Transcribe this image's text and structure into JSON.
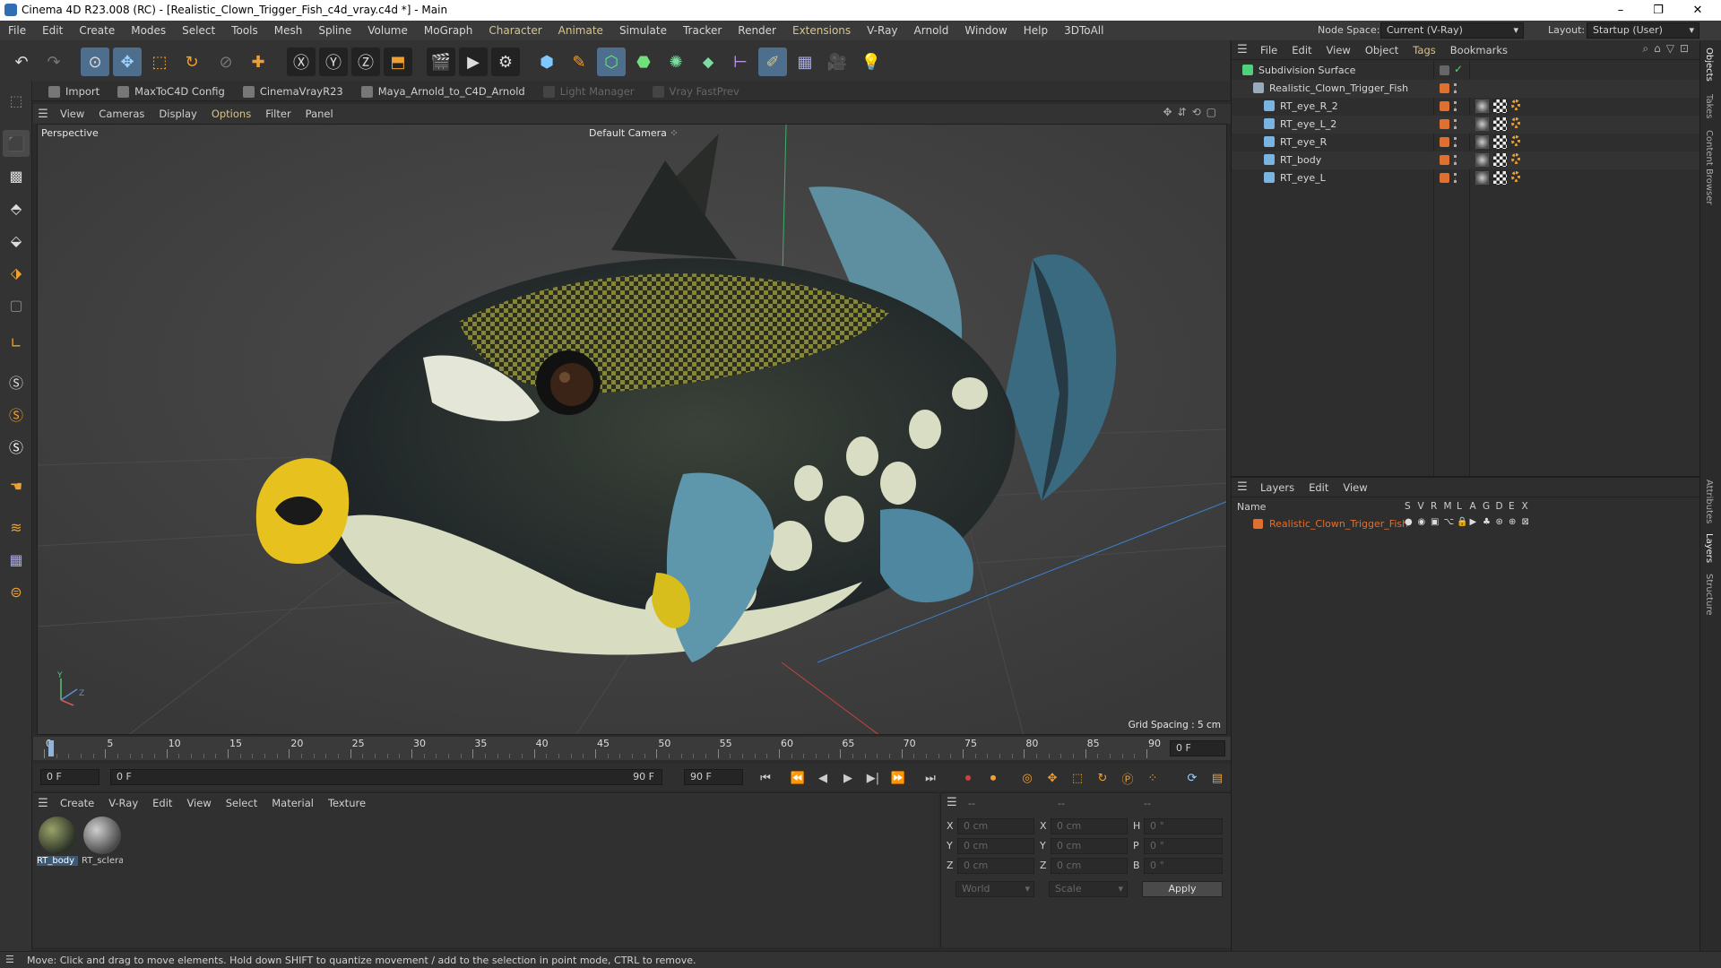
{
  "window": {
    "title": "Cinema 4D R23.008 (RC) - [Realistic_Clown_Trigger_Fish_c4d_vray.c4d *] - Main",
    "controls": [
      "–",
      "❐",
      "✕"
    ]
  },
  "menubar": {
    "items": [
      "File",
      "Edit",
      "Create",
      "Modes",
      "Select",
      "Tools",
      "Mesh",
      "Spline",
      "Volume",
      "MoGraph",
      "Character",
      "Animate",
      "Simulate",
      "Tracker",
      "Render",
      "Extensions",
      "V-Ray",
      "Arnold",
      "Window",
      "Help",
      "3DToAll"
    ],
    "highlighted": [
      "Character",
      "Animate",
      "Extensions"
    ],
    "node_space_label": "Node Space:",
    "node_space_value": "Current (V-Ray)",
    "layout_label": "Layout:",
    "layout_value": "Startup (User)"
  },
  "pluginbar": {
    "items": [
      {
        "label": "Import",
        "dim": false
      },
      {
        "label": "MaxToC4D Config",
        "dim": false
      },
      {
        "label": "CinemaVrayR23",
        "dim": false
      },
      {
        "label": "Maya_Arnold_to_C4D_Arnold",
        "dim": false
      },
      {
        "label": "Light Manager",
        "dim": true
      },
      {
        "label": "Vray FastPrev",
        "dim": true
      }
    ]
  },
  "viewport": {
    "menu": [
      "View",
      "Cameras",
      "Display",
      "Options",
      "Filter",
      "Panel"
    ],
    "menu_highlighted": "Options",
    "view_name": "Perspective",
    "camera_name": "Default Camera",
    "grid_spacing": "Grid Spacing : 5 cm",
    "axis_y": "Y",
    "axis_z": "Z"
  },
  "timeline": {
    "ticks": [
      "0",
      "5",
      "10",
      "15",
      "20",
      "25",
      "30",
      "35",
      "40",
      "45",
      "50",
      "55",
      "60",
      "65",
      "70",
      "75",
      "80",
      "85",
      "90"
    ],
    "frame_field": "0 F",
    "current_frame": "0 F",
    "range_start": "0 F",
    "range_end_inline": "90 F",
    "range_end": "90 F"
  },
  "material_manager": {
    "menu": [
      "Create",
      "V-Ray",
      "Edit",
      "View",
      "Select",
      "Material",
      "Texture"
    ],
    "materials": [
      {
        "name": "RT_body"
      },
      {
        "name": "RT_sclera"
      }
    ]
  },
  "coordinates": {
    "header": [
      "--",
      "--",
      "--"
    ],
    "rows": [
      {
        "a_label": "X",
        "a_val": "0 cm",
        "b_label": "X",
        "b_val": "0 cm",
        "c_label": "H",
        "c_val": "0 °"
      },
      {
        "a_label": "Y",
        "a_val": "0 cm",
        "b_label": "Y",
        "b_val": "0 cm",
        "c_label": "P",
        "c_val": "0 °"
      },
      {
        "a_label": "Z",
        "a_val": "0 cm",
        "b_label": "Z",
        "b_val": "0 cm",
        "c_label": "B",
        "c_val": "0 °"
      }
    ],
    "space": "World",
    "mode": "Scale",
    "apply": "Apply"
  },
  "object_manager": {
    "menu": [
      "File",
      "Edit",
      "View",
      "Object",
      "Tags",
      "Bookmarks"
    ],
    "menu_highlighted": "Tags",
    "objects": [
      {
        "name": "Subdivision Surface",
        "level": 0
      },
      {
        "name": "Realistic_Clown_Trigger_Fish",
        "level": 1
      },
      {
        "name": "RT_eye_R_2",
        "level": 2
      },
      {
        "name": "RT_eye_L_2",
        "level": 2
      },
      {
        "name": "RT_eye_R",
        "level": 2
      },
      {
        "name": "RT_body",
        "level": 2
      },
      {
        "name": "RT_eye_L",
        "level": 2
      }
    ]
  },
  "layer_manager": {
    "menu": [
      "Layers",
      "Edit",
      "View"
    ],
    "col_name": "Name",
    "col_flags": [
      "S",
      "V",
      "R",
      "M",
      "L",
      "A",
      "G",
      "D",
      "E",
      "X"
    ],
    "layers": [
      {
        "name": "Realistic_Clown_Trigger_Fish",
        "color": "#e07030"
      }
    ]
  },
  "right_tabs": [
    "Objects",
    "Takes",
    "Content Browser",
    "Attributes",
    "Layers",
    "Structure"
  ],
  "status": "Move: Click and drag to move elements. Hold down SHIFT to quantize movement / add to the selection in point mode, CTRL to remove.",
  "colors": {
    "accent": "#d6c48a",
    "layer": "#e07030",
    "active_tool": "#4d6f8d"
  }
}
